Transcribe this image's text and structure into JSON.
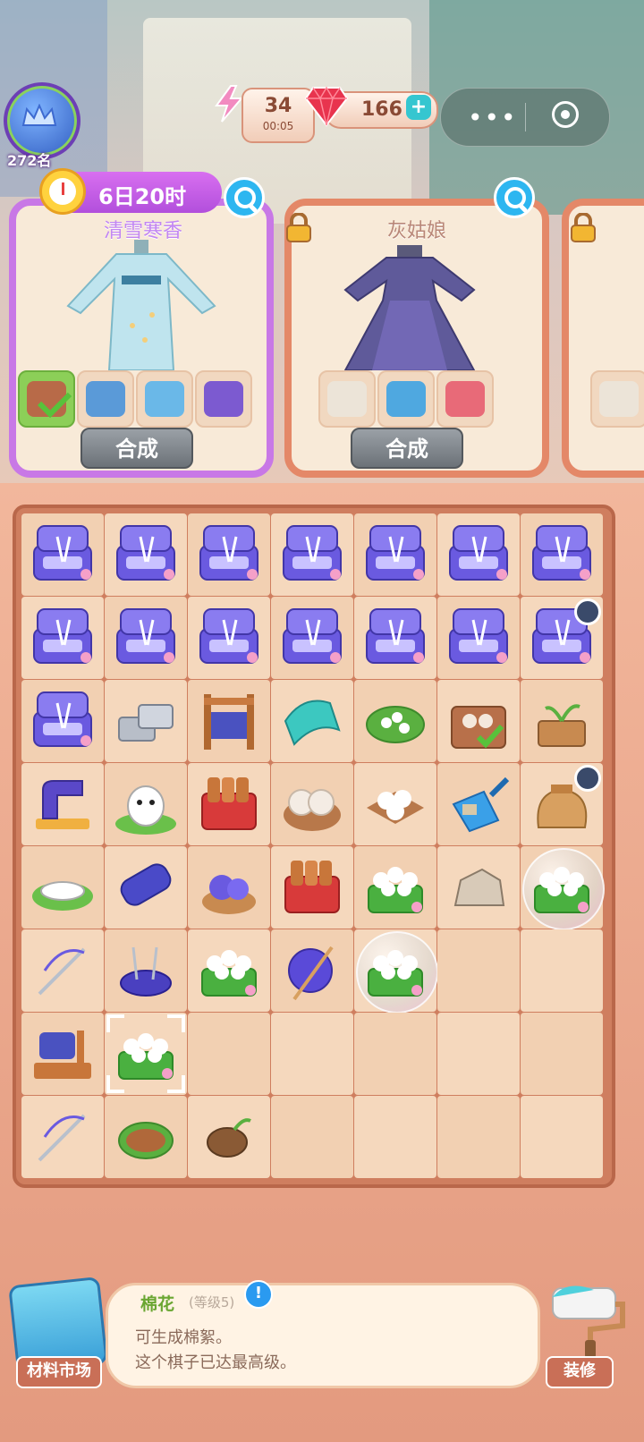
{
  "hud": {
    "rank": "272名",
    "energy": "34",
    "energy_timer": "00:05",
    "gems": "166",
    "gems_plus": "+",
    "capsule_menu": "•••"
  },
  "cards": [
    {
      "timer": "6日20时",
      "title": "清雪寒香",
      "combine": "合成",
      "locked": false
    },
    {
      "title": "灰姑娘",
      "combine": "合成",
      "locked": true
    },
    {
      "locked": true
    }
  ],
  "board": {
    "cols": 7,
    "rows": 8,
    "items": [
      [
        "sewing-box",
        "sewing-box",
        "sewing-box",
        "sewing-box",
        "sewing-box",
        "sewing-box",
        "sewing-box"
      ],
      [
        "sewing-box",
        "sewing-box",
        "sewing-box",
        "sewing-box",
        "sewing-box",
        "sewing-box",
        "sewing-box"
      ],
      [
        "sewing-box",
        "stone-blocks",
        "loom",
        "fabric",
        "cotton-seeds",
        "leather-bag",
        "sprout-pot"
      ],
      [
        "sewing-machine",
        "white-dog",
        "thread-spools",
        "rolled-fabric",
        "cotton-bolls",
        "dustpan",
        "seed-bag"
      ],
      [
        "silkworm",
        "thread-roll",
        "yarn-basket",
        "thread-spools",
        "cotton-plant",
        "rock",
        "cotton-plant"
      ],
      [
        "needle",
        "pincushion",
        "cotton-plant",
        "yarn-ball",
        "cotton-plant",
        "",
        ""
      ],
      [
        "spool-rack",
        "cotton-plant",
        "",
        "",
        "",
        "",
        ""
      ],
      [
        "needle",
        "soil-pot",
        "seed",
        "",
        "",
        "",
        ""
      ]
    ],
    "bubbles": [
      [
        4,
        6
      ],
      [
        5,
        4
      ]
    ],
    "timers": [
      [
        1,
        6
      ],
      [
        3,
        6
      ]
    ],
    "selected": [
      6,
      1
    ]
  },
  "footer": {
    "market": "材料市场",
    "item_name": "棉花",
    "item_level": "(等级5)",
    "info_icon": "!",
    "desc_line1": "可生成棉絮。",
    "desc_line2": "这个棋子已达最高级。",
    "decorate": "装修"
  }
}
